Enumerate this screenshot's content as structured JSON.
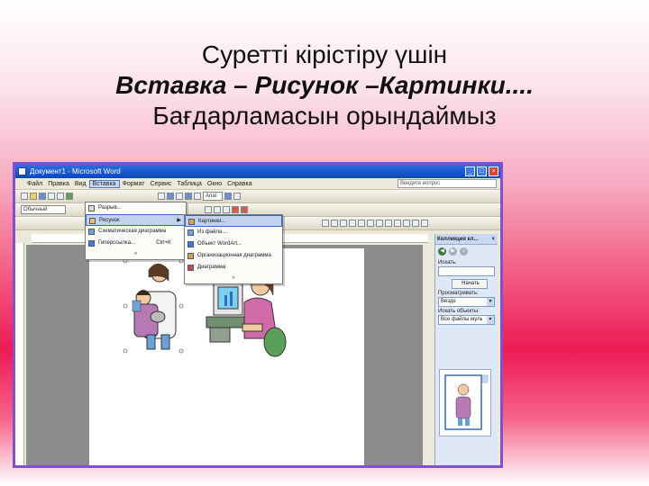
{
  "slide": {
    "line1": "Суретті кірістіру үшін",
    "line2": "Вставка – Рисунок –Картинки....",
    "line3": "Бағдарламасын орындаймыз"
  },
  "window": {
    "title": "Документ1 - Microsoft Word",
    "menu": [
      "Файл",
      "Правка",
      "Вид",
      "Вставка",
      "Формат",
      "Сервис",
      "Таблица",
      "Окно",
      "Справка"
    ],
    "help_placeholder": "Введите вопрос",
    "style_combo": "Обычный",
    "zoom_combo": "Arial"
  },
  "insert_menu": {
    "items": [
      {
        "label": "Разрыв...",
        "shortcut": "",
        "submenu": false
      },
      {
        "label": "Рисунок",
        "shortcut": "",
        "submenu": true
      },
      {
        "label": "Схематическая диаграмма",
        "shortcut": "",
        "submenu": false
      },
      {
        "label": "Гиперссылка...",
        "shortcut": "Ctrl+K",
        "submenu": false
      }
    ],
    "more": "»"
  },
  "picture_submenu": {
    "items": [
      {
        "label": "Картинки...",
        "icon": "clipart-icon",
        "color": "#d9a441"
      },
      {
        "label": "Из файла...",
        "icon": "from-file-icon",
        "color": "#6fa4d8"
      },
      {
        "label": "Объект WordArt...",
        "icon": "wordart-icon",
        "color": "#3a7ed8"
      },
      {
        "label": "Организационная диаграмма",
        "icon": "orgchart-icon",
        "color": "#d8a040"
      },
      {
        "label": "Диаграмма",
        "icon": "chart-icon",
        "color": "#c84a4a"
      }
    ],
    "more": "»"
  },
  "task_pane": {
    "title": "Коллекция кл...",
    "close": "×",
    "search_label": "Искать:",
    "search_button": "Начать",
    "search_in_label": "Просматривать:",
    "search_in_value": "Везде",
    "types_label": "Искать объекты:",
    "types_value": "Все файлы мультимедиа"
  },
  "colors": {
    "frame": "#7f4fd6",
    "titlebar": "#0a47c0",
    "highlight": "#c1d2ee"
  }
}
